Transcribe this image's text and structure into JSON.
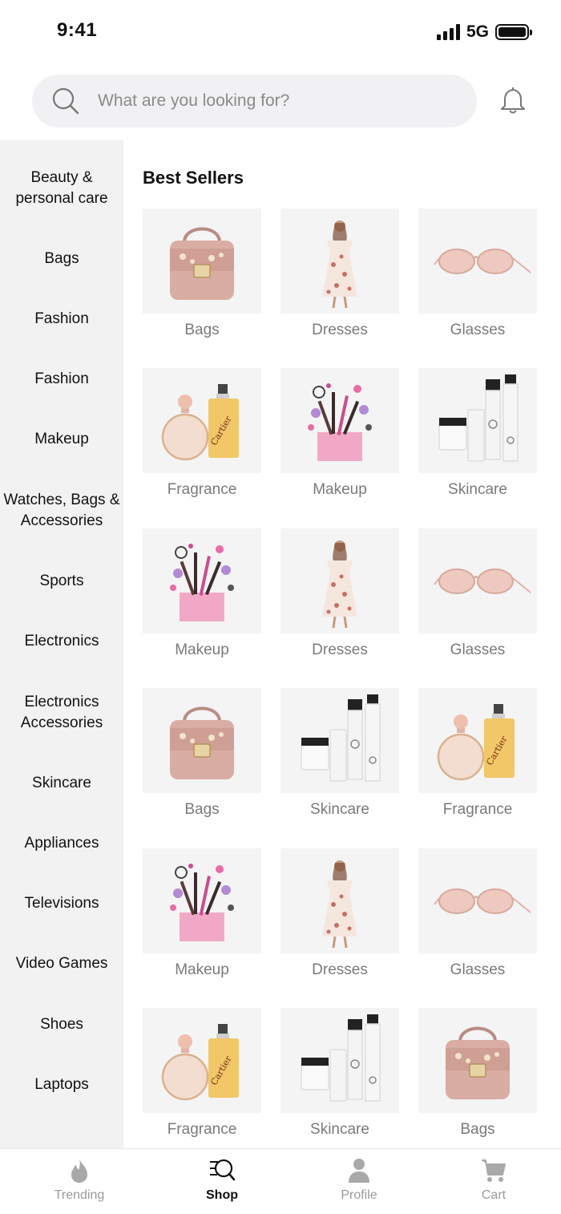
{
  "status_bar": {
    "time": "9:41",
    "network": "5G"
  },
  "search": {
    "placeholder": "What are you looking for?"
  },
  "sidebar": {
    "items": [
      "Beauty & personal care",
      "Bags",
      "Fashion",
      "Fashion",
      "Makeup",
      "Watches, Bags & Accessories",
      "Sports",
      "Electronics",
      "Electronics Accessories",
      "Skincare",
      "Appliances",
      "Televisions",
      "Video Games",
      "Shoes",
      "Laptops"
    ]
  },
  "main": {
    "section_title": "Best Sellers",
    "tiles": [
      {
        "label": "Bags",
        "icon": "handbag-icon"
      },
      {
        "label": "Dresses",
        "icon": "dress-icon"
      },
      {
        "label": "Glasses",
        "icon": "sunglasses-icon"
      },
      {
        "label": "Fragrance",
        "icon": "perfume-icon"
      },
      {
        "label": "Makeup",
        "icon": "makeup-kit-icon"
      },
      {
        "label": "Skincare",
        "icon": "skincare-icon"
      },
      {
        "label": "Makeup",
        "icon": "makeup-kit-icon"
      },
      {
        "label": "Dresses",
        "icon": "dress-icon"
      },
      {
        "label": "Glasses",
        "icon": "sunglasses-icon"
      },
      {
        "label": "Bags",
        "icon": "handbag-icon"
      },
      {
        "label": "Skincare",
        "icon": "skincare-icon"
      },
      {
        "label": "Fragrance",
        "icon": "perfume-icon"
      },
      {
        "label": "Makeup",
        "icon": "makeup-kit-icon"
      },
      {
        "label": "Dresses",
        "icon": "dress-icon"
      },
      {
        "label": "Glasses",
        "icon": "sunglasses-icon"
      },
      {
        "label": "Fragrance",
        "icon": "perfume-icon"
      },
      {
        "label": "Skincare",
        "icon": "skincare-icon"
      },
      {
        "label": "Bags",
        "icon": "handbag-icon"
      }
    ]
  },
  "bottom_nav": {
    "items": [
      {
        "label": "Trending",
        "icon": "flame-icon",
        "active": false
      },
      {
        "label": "Shop",
        "icon": "shop-search-icon",
        "active": true
      },
      {
        "label": "Profile",
        "icon": "person-icon",
        "active": false
      },
      {
        "label": "Cart",
        "icon": "cart-icon",
        "active": false
      }
    ]
  },
  "colors": {
    "sidebar_bg": "#f2f2f3",
    "tile_bg": "#f4f4f5",
    "inactive_text": "#9a9a9a",
    "active_text": "#111111"
  }
}
